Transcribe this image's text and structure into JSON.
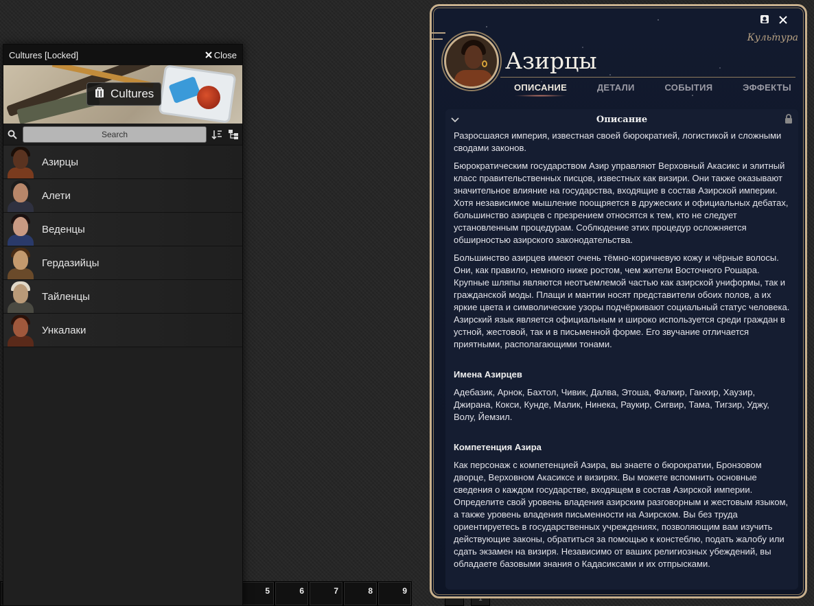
{
  "hotbar": {
    "slots": [
      "",
      "",
      "",
      "",
      "",
      "",
      "",
      "5",
      "6",
      "7",
      "8",
      "9"
    ],
    "extra": "1"
  },
  "sidebar": {
    "title": "Cultures [Locked]",
    "close_label": "Close",
    "banner_label": "Cultures",
    "search_placeholder": "Search",
    "entries": [
      {
        "label": "Азирцы",
        "skin": "#5a3320",
        "hair": "#1a0e08",
        "body": "#7a3b1e"
      },
      {
        "label": "Алети",
        "skin": "#b8876a",
        "hair": "#1c1c1c",
        "body": "#2f3140"
      },
      {
        "label": "Веденцы",
        "skin": "#c99a83",
        "hair": "#1a1010",
        "body": "#2a3a6a"
      },
      {
        "label": "Гердазийцы",
        "skin": "#c49a6e",
        "hair": "#4a2d15",
        "body": "#6a4a2a"
      },
      {
        "label": "Тайленцы",
        "skin": "#b99a78",
        "hair": "#e0d8c8",
        "body": "#4a4a42"
      },
      {
        "label": "Ункалаки",
        "skin": "#a0583c",
        "hair": "#2a120a",
        "body": "#5a2a1a"
      }
    ]
  },
  "sheet": {
    "type_label": "Культура",
    "title": "Азирцы",
    "tabs": [
      "ОПИСАНИЕ",
      "ДЕТАЛИ",
      "СОБЫТИЯ",
      "ЭФФЕКТЫ"
    ],
    "active_tab": 0,
    "section_title": "Описание",
    "paragraphs": [
      "Разросшаяся империя, известная своей бюрократией, логистикой и сложными сводами законов.",
      "Бюрократическим государством Азир управляют Верховный Акасикс и элитный класс правительственных писцов, известных как визири. Они также оказывают значительное влияние на государства, входящие в состав Азирской империи. Хотя независимое мышление поощряется в дружеских и официальных дебатах, большинство азирцев с презрением относятся к тем, кто не следует установленным процедурам. Соблюдение этих процедур осложняется обширностью азирского законодательства.",
      "Большинство азирцев имеют очень тёмно-коричневую кожу и чёрные волосы. Они, как правило, немного ниже ростом, чем жители Восточного Рошара. Крупные шляпы являются неотъемлемой частью как азирской униформы, так и гражданской моды. Плащи и мантии носят представители обоих полов, а их яркие цвета и символические узоры подчёркивают социальный статус человека. Азирский язык является официальным и широко используется среди граждан в устной, жестовой, так и в письменной форме. Его звучание отличается приятными, располагающими тонами."
    ],
    "names_heading": "Имена Азирцев",
    "names_text": "Адебазик, Арнок, Бахтол, Чивик, Далва, Этоша, Фалкир, Ганхир, Хаузир, Джирана, Кокси, Кунде, Малик, Нинека, Раукир, Сигвир, Тама, Тигзир, Уджу, Волу, Йемзил.",
    "expertise_heading": "Компетенция Азира",
    "expertise_text": "Как персонаж с компетенцией Азира, вы знаете о бюрократии, Бронзовом дворце, Верховном Акасиксе и визирях. Вы можете вспомнить основные сведения о каждом государстве, входящем в состав Азирской империи. Определите свой уровень владения азирским разговорным и жестовым языком, а также уровень владения письменности на Азирском. Вы без труда ориентируетесь в государственных учреждениях, позволяющим вам изучить действующие законы, обратиться за помощью к констеблю, подать жалобу или сдать экзамен на визиря. Независимо от ваших религиозных убеждений, вы обладаете базовыми знания о Кадасиксами и их отпрысками."
  }
}
